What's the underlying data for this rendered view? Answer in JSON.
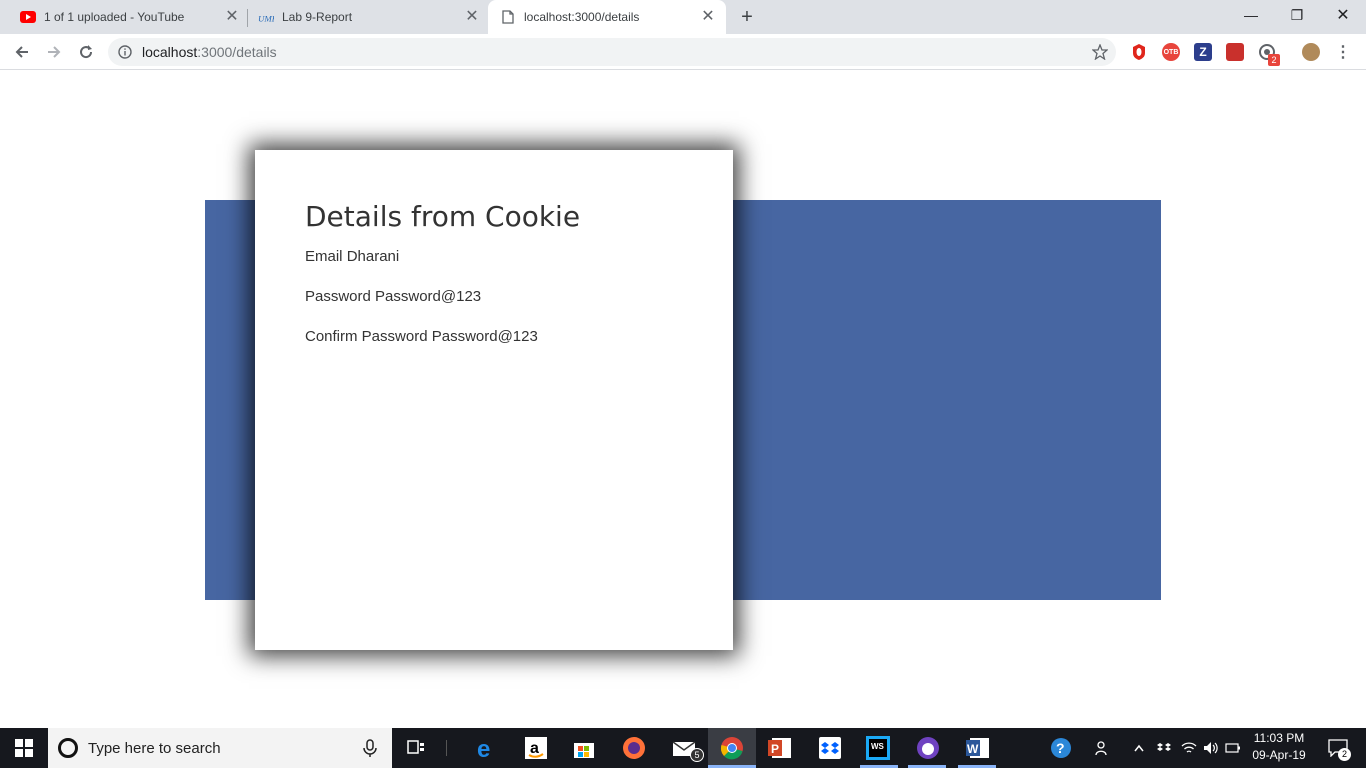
{
  "browser": {
    "tabs": [
      {
        "title": "1 of 1 uploaded - YouTube",
        "favicon": "youtube-icon"
      },
      {
        "title": "Lab 9-Report",
        "favicon": "umkc-icon"
      },
      {
        "title": "localhost:3000/details",
        "favicon": "page-icon",
        "active": true
      }
    ],
    "new_tab_glyph": "+",
    "close_glyph": "✕",
    "window_controls": {
      "minimize": "—",
      "restore": "❐",
      "close": "✕"
    },
    "address": {
      "host": "localhost",
      "path": ":3000/details"
    },
    "extensions": [
      "opera-icon",
      "tabs-icon",
      "zotero-icon",
      "bookmark-icon",
      "feed-icon",
      "profile-avatar"
    ],
    "extension_badge": "2"
  },
  "page": {
    "heading": "Details from Cookie",
    "fields": [
      {
        "label": "Email",
        "value": "Dharani"
      },
      {
        "label": "Password",
        "value": "Password@123"
      },
      {
        "label": "Confirm Password",
        "value": "Password@123"
      }
    ],
    "colors": {
      "band": "#4766a2",
      "card": "#ffffff"
    }
  },
  "taskbar": {
    "search_placeholder": "Type here to search",
    "mail_badge": "5",
    "clock_time": "11:03 PM",
    "clock_date": "09-Apr-19",
    "notification_count": "2",
    "apps": [
      "task-view-icon",
      "edge-icon",
      "amazon-icon",
      "store-icon",
      "firefox-icon",
      "mail-icon",
      "chrome-icon",
      "powerpoint-icon",
      "dropbox-icon",
      "webstorm-icon",
      "github-desktop-icon",
      "word-icon"
    ]
  }
}
